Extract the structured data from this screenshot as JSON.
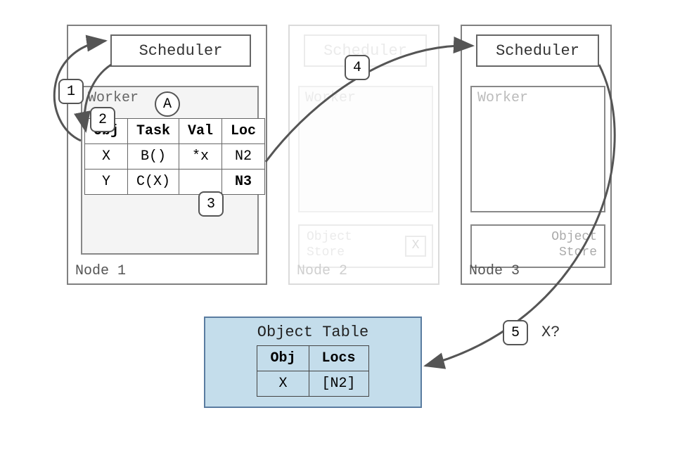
{
  "nodes": {
    "n1": {
      "label": "Node 1",
      "scheduler": "Scheduler",
      "worker": "Worker"
    },
    "n2": {
      "label": "Node 2",
      "scheduler": "Scheduler",
      "worker": "Worker",
      "objstore": "Object\nStore",
      "objstore_item": "X"
    },
    "n3": {
      "label": "Node 3",
      "scheduler": "Scheduler",
      "worker": "Worker",
      "objstore": "Object\nStore"
    }
  },
  "worker_table": {
    "headers": [
      "Obj",
      "Task",
      "Val",
      "Loc"
    ],
    "rows": [
      [
        "X",
        "B()",
        "*x",
        "N2"
      ],
      [
        "Y",
        "C(X)",
        "",
        "N3"
      ]
    ]
  },
  "badges": {
    "A": "A",
    "s1": "1",
    "s2": "2",
    "s3": "3",
    "s4": "4",
    "s5": "5"
  },
  "object_table": {
    "title": "Object Table",
    "headers": [
      "Obj",
      "Locs"
    ],
    "rows": [
      [
        "X",
        "[N2]"
      ]
    ]
  },
  "query_label": "X?"
}
